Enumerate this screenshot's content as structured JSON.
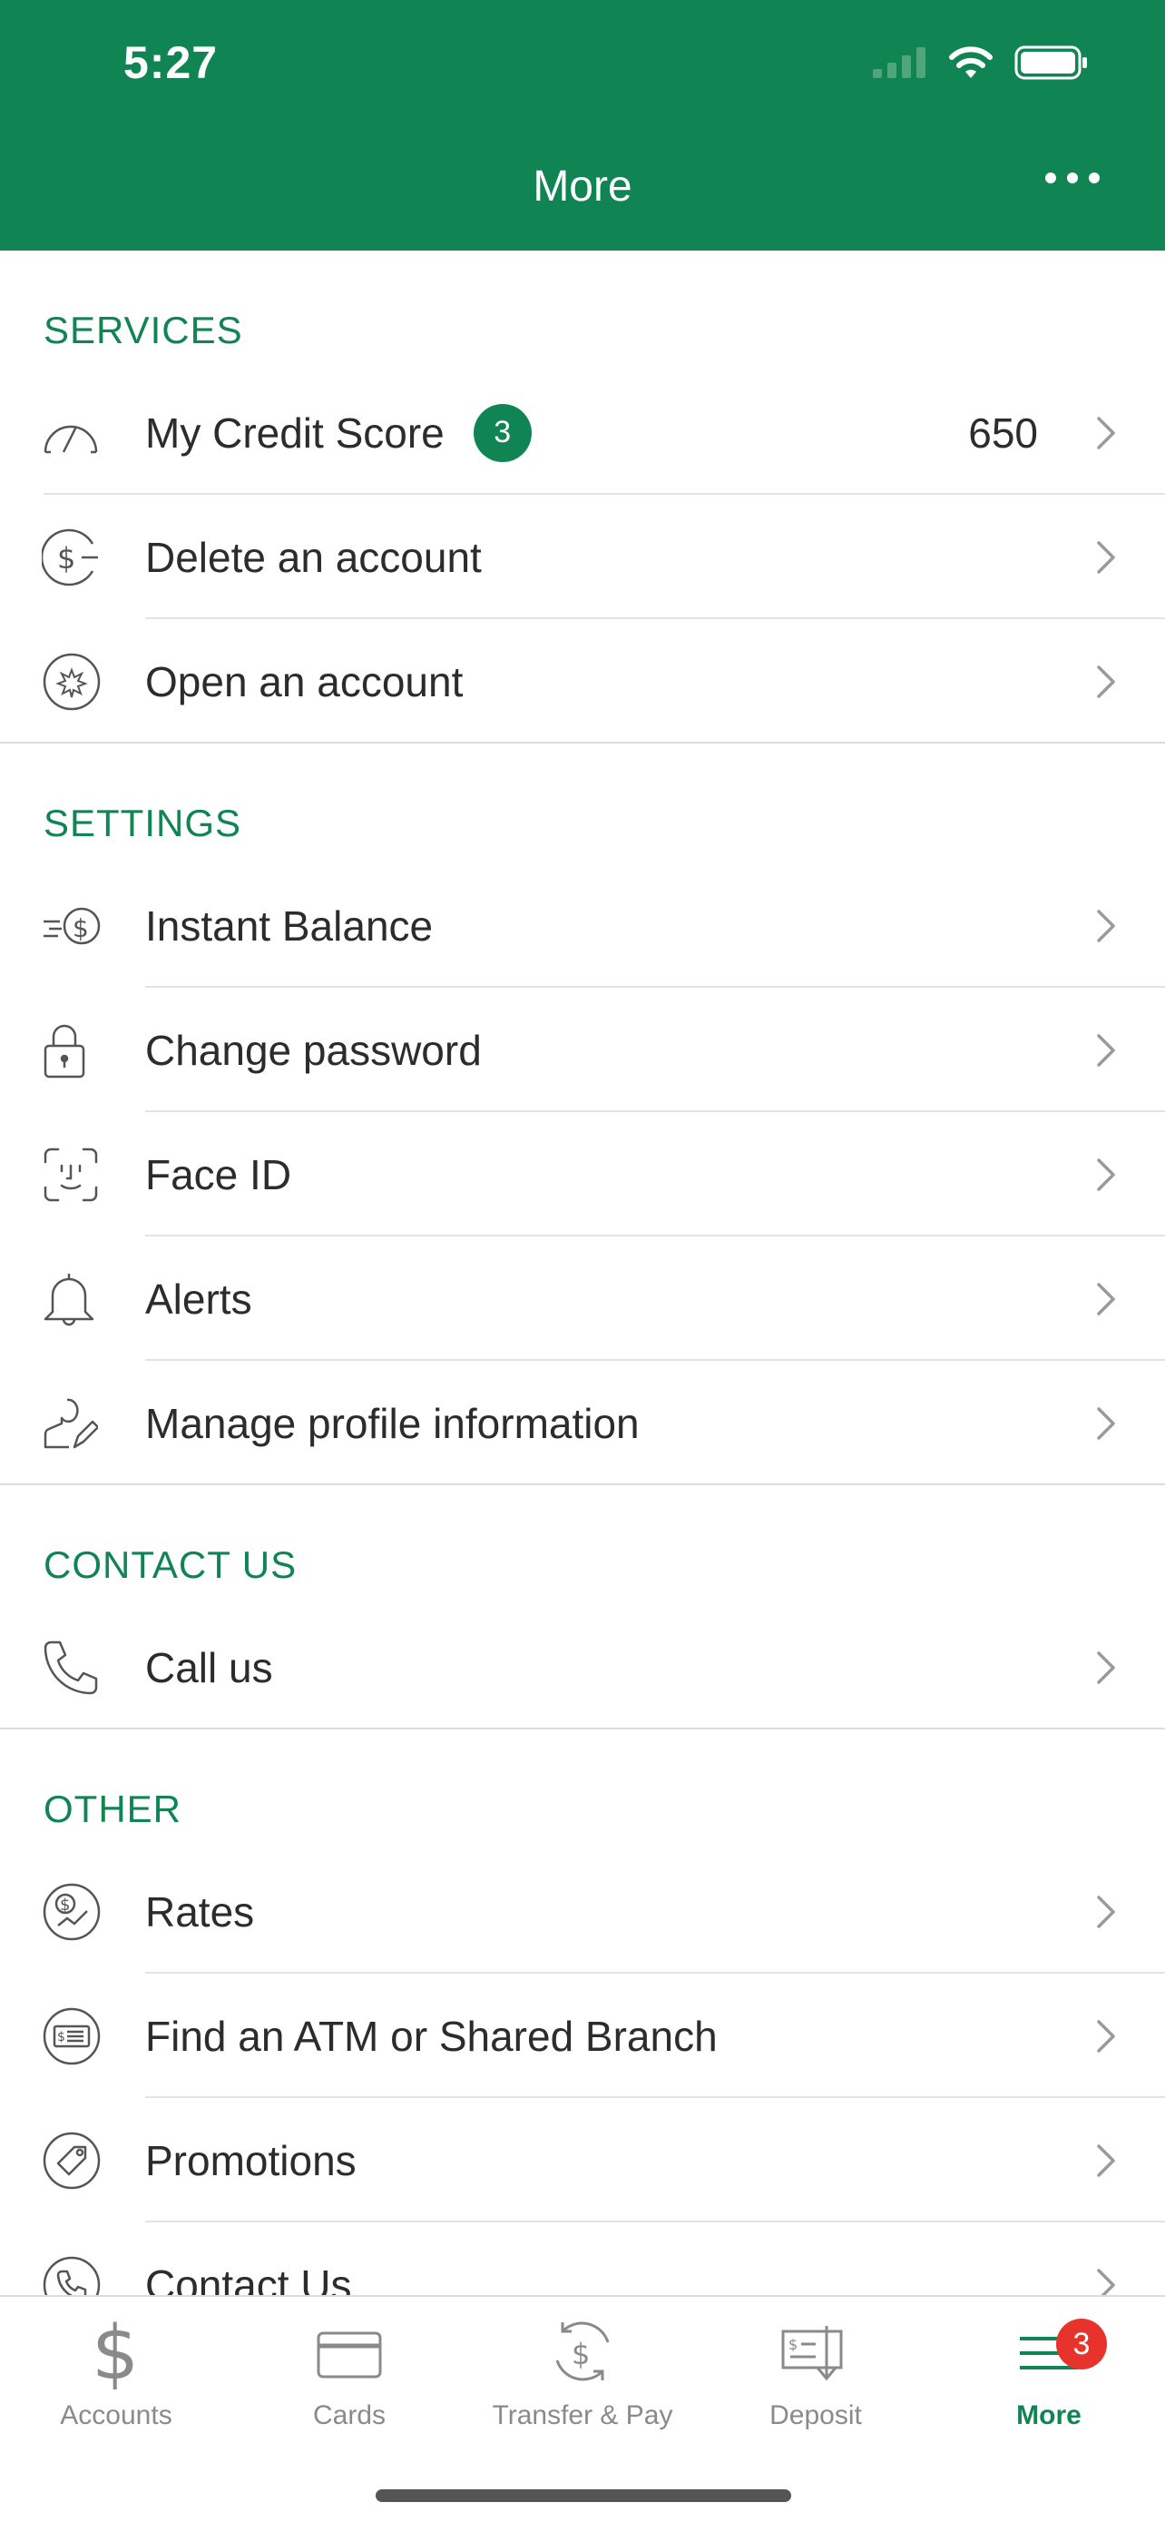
{
  "status_bar": {
    "time": "5:27"
  },
  "header": {
    "title": "More"
  },
  "sections": [
    {
      "title": "SERVICES",
      "items": [
        {
          "label": "My Credit Score",
          "badge": "3",
          "value": "650",
          "icon": "speedometer-icon"
        },
        {
          "label": "Delete an account",
          "icon": "dollar-minus-icon"
        },
        {
          "label": "Open an account",
          "icon": "starburst-icon"
        }
      ]
    },
    {
      "title": "SETTINGS",
      "items": [
        {
          "label": "Instant Balance",
          "icon": "fast-dollar-icon"
        },
        {
          "label": "Change password",
          "icon": "lock-icon"
        },
        {
          "label": "Face ID",
          "icon": "face-id-icon"
        },
        {
          "label": "Alerts",
          "icon": "bell-icon"
        },
        {
          "label": "Manage profile information",
          "icon": "profile-edit-icon"
        }
      ]
    },
    {
      "title": "CONTACT US",
      "items": [
        {
          "label": "Call us",
          "icon": "phone-icon"
        }
      ]
    },
    {
      "title": "OTHER",
      "items": [
        {
          "label": "Rates",
          "icon": "rates-icon"
        },
        {
          "label": "Find an ATM or Shared Branch",
          "icon": "atm-icon"
        },
        {
          "label": "Promotions",
          "icon": "tag-icon"
        },
        {
          "label": "Contact Us",
          "icon": "phone-circle-icon"
        }
      ]
    }
  ],
  "tabbar": {
    "tabs": [
      {
        "label": "Accounts",
        "icon": "dollar-icon"
      },
      {
        "label": "Cards",
        "icon": "card-icon"
      },
      {
        "label": "Transfer & Pay",
        "icon": "transfer-icon"
      },
      {
        "label": "Deposit",
        "icon": "check-deposit-icon"
      },
      {
        "label": "More",
        "icon": "menu-icon",
        "badge": "3",
        "active": true
      }
    ]
  },
  "colors": {
    "brand": "#118454",
    "badge_red": "#e8322c"
  }
}
